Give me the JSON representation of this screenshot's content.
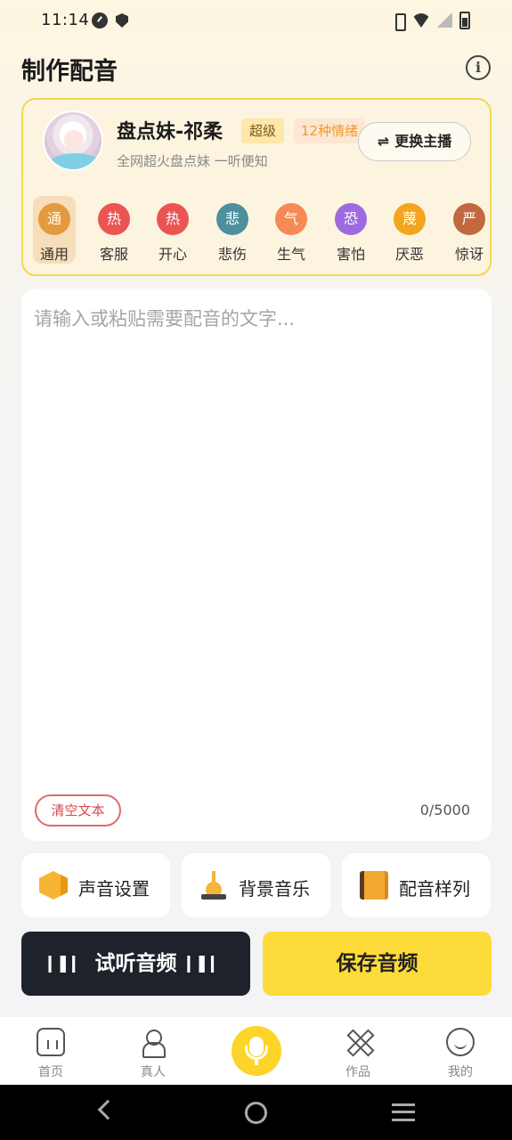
{
  "status_bar": {
    "time": "11:14"
  },
  "header": {
    "title": "制作配音",
    "info_icon": "i"
  },
  "anchor": {
    "name": "盘点妹-祁柔",
    "level_badge": "超级",
    "emotions_badge": "12种情绪",
    "description": "全网超火盘点妹 一听便知",
    "switch_label": "更换主播",
    "switch_icon": "⇌"
  },
  "emotions": [
    {
      "icon_text": "通",
      "label": "通用",
      "color": "#e39a3c",
      "active": true
    },
    {
      "icon_text": "热",
      "label": "客服",
      "color": "#ec5454",
      "active": false
    },
    {
      "icon_text": "热",
      "label": "开心",
      "color": "#ec5454",
      "active": false
    },
    {
      "icon_text": "悲",
      "label": "悲伤",
      "color": "#4e8f9d",
      "active": false
    },
    {
      "icon_text": "气",
      "label": "生气",
      "color": "#f58a56",
      "active": false
    },
    {
      "icon_text": "恐",
      "label": "害怕",
      "color": "#9e6ae0",
      "active": false
    },
    {
      "icon_text": "蔑",
      "label": "厌恶",
      "color": "#f2a51d",
      "active": false
    },
    {
      "icon_text": "严",
      "label": "惊讶",
      "color": "#c0693e",
      "active": false
    }
  ],
  "editor": {
    "placeholder": "请输入或粘贴需要配音的文字...",
    "value": "",
    "clear_label": "清空文本",
    "char_count": "0/5000"
  },
  "tools": {
    "voice_settings": "声音设置",
    "background_music": "背景音乐",
    "dubbing_samples": "配音样列"
  },
  "actions": {
    "preview_label": "试听音频",
    "save_label": "保存音频"
  },
  "bottom_nav": {
    "home": "首页",
    "real_person": "真人",
    "works": "作品",
    "mine": "我的"
  },
  "colors": {
    "accent_yellow": "#fddb3a",
    "card_border": "#f3d84f",
    "preview_bg": "#1e222b",
    "clear_red": "#e06a6a"
  }
}
